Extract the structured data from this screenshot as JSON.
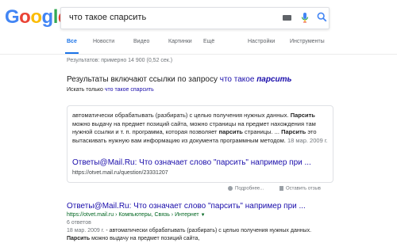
{
  "logo": {
    "letters": [
      "G",
      "o",
      "o",
      "g",
      "l",
      "e"
    ],
    "colors": [
      "#4285F4",
      "#EA4335",
      "#FBBC05",
      "#4285F4",
      "#34A853",
      "#EA4335"
    ]
  },
  "search": {
    "query": "что такое спарсить"
  },
  "tabs": [
    {
      "label": "Все",
      "active": true
    },
    {
      "label": "Новости"
    },
    {
      "label": "Видео"
    },
    {
      "label": "Картинки"
    },
    {
      "label": "Ещё"
    },
    {
      "label": "Настройки"
    },
    {
      "label": "Инструменты"
    }
  ],
  "stats": "Результатов: примерно 14 900 (0,52 сек.)",
  "spell": {
    "prefix": "Результаты включают ссылки по запросу ",
    "link_normal": "что такое ",
    "link_bold": "парсить",
    "alt_prefix": "Искать только ",
    "alt_link": "что такое спарсить"
  },
  "snippet": {
    "line1": "автоматически обрабатывать (разбирать) с целью получения нужных данных.",
    "b1": "Парсить",
    "t2": " можно выдачу на предмет позиций сайта, можно страницы на предмет нахождения там нужной ссылки и т. п. программа, которая позволяет ",
    "b2": "парсить",
    "t3": " страницы. ... ",
    "b3": "Парсить",
    "t4": " это вытаскивать нужную вам информацию из документа программным методом. ",
    "date": "18 мар. 2009 г.",
    "title": "Ответы@Mail.Ru: Что означает слово \"парсить\" например при ...",
    "url": "https://otvet.mail.ru/question/23331207"
  },
  "feedback": {
    "about": "Подробнее...",
    "report": "Оставить отзыв"
  },
  "result": {
    "title": "Ответы@Mail.Ru: Что означает слово \"парсить\" например при ...",
    "url": "https://otvet.mail.ru › Компьютеры, Связь › Интернет",
    "arrow": "▼",
    "meta": "6 ответов",
    "date": "18 мар. 2009 г.",
    "text": " - автоматически обрабатывать (разбирать) с целью получения нужных данных.",
    "text2_bold": "Парсить",
    "text2": " можно выдачу на предмет позиций сайта,"
  }
}
